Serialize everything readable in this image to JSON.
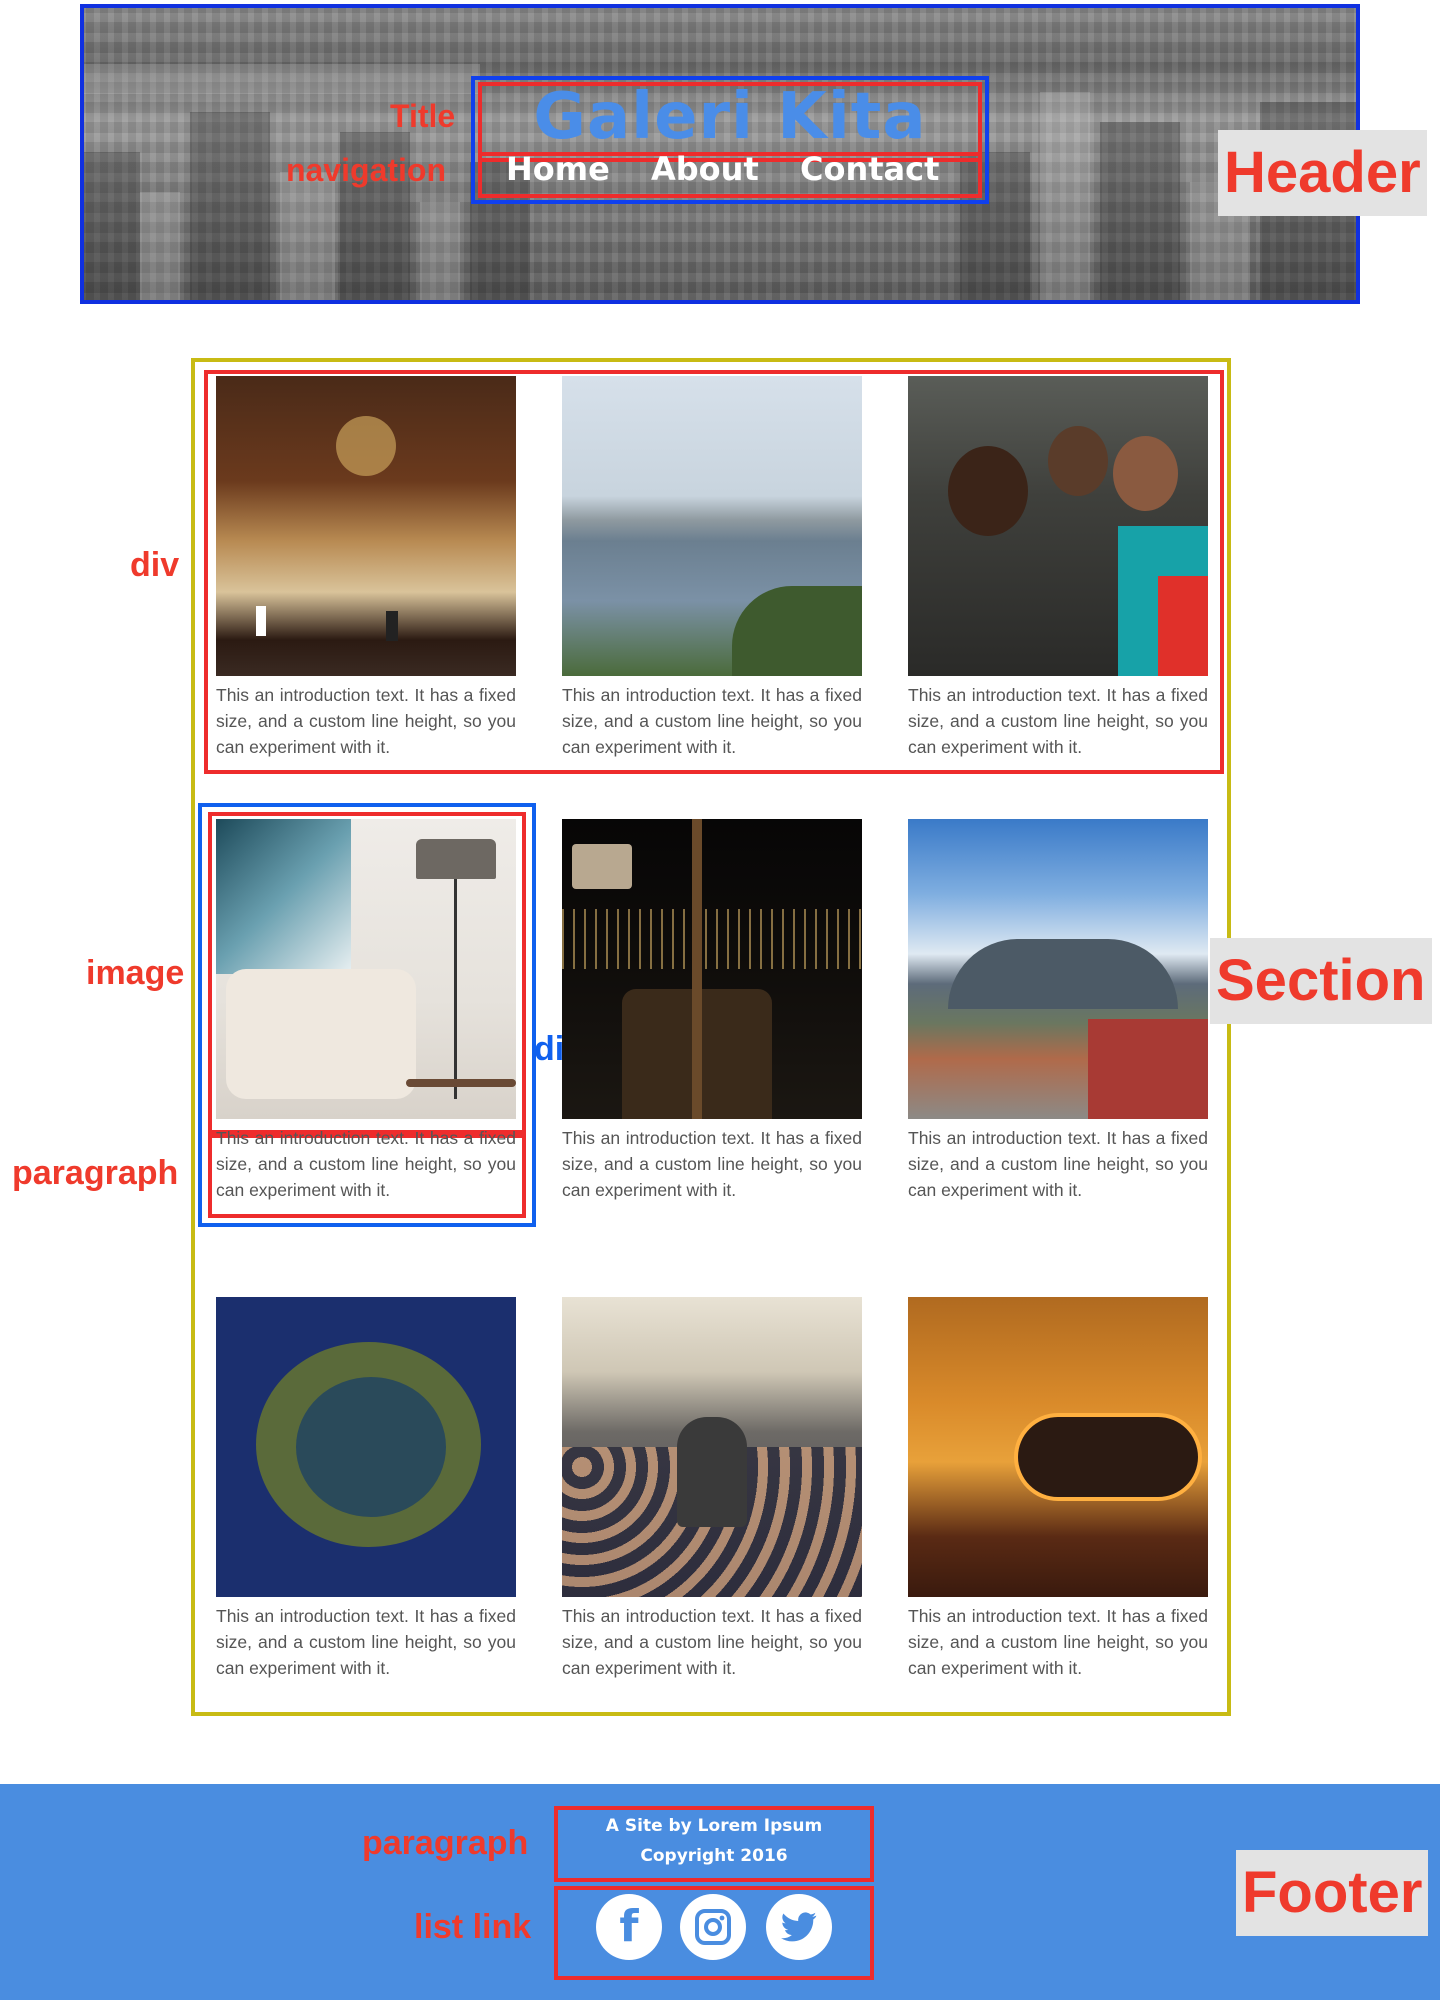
{
  "header": {
    "title": "Galeri Kita",
    "nav": [
      "Home",
      "About",
      "Contact"
    ],
    "labels": {
      "title": "Title",
      "navigation": "navigation",
      "header": "Header"
    }
  },
  "section": {
    "label": "Section",
    "annotations": {
      "div_row": "div",
      "image": "image",
      "div_card": "div",
      "paragraph": "paragraph"
    },
    "cards": [
      {
        "image": "hotel-lobby-photo",
        "text": "This an introduction text. It has a fixed size, and a custom line height, so you can experiment with it."
      },
      {
        "image": "lake-city-view-photo",
        "text": "This an introduction text. It has a fixed size, and a custom line height, so you can experiment with it."
      },
      {
        "image": "group-portrait-photo",
        "text": "This an introduction text. It has a fixed size, and a custom line height, so you can experiment with it."
      },
      {
        "image": "living-room-photo",
        "text": "This an introduction text. It has a fixed size, and a custom line height, so you can experiment with it."
      },
      {
        "image": "night-balcony-photo",
        "text": "This an introduction text. It has a fixed size, and a custom line height, so you can experiment with it."
      },
      {
        "image": "volcano-town-photo",
        "text": "This an introduction text. It has a fixed size, and a custom line height, so you can experiment with it."
      },
      {
        "image": "island-crater-photo",
        "text": "This an introduction text. It has a fixed size, and a custom line height, so you can experiment with it."
      },
      {
        "image": "crowd-selfie-photo",
        "text": "This an introduction text. It has a fixed size, and a custom line height, so you can experiment with it."
      },
      {
        "image": "sunset-cloud-photo",
        "text": "This an introduction text. It has a fixed size, and a custom line height, so you can experiment with it."
      }
    ]
  },
  "footer": {
    "lines": [
      "A Site by Lorem Ipsum",
      "Copyright 2016"
    ],
    "social": [
      {
        "icon": "facebook-icon",
        "glyph": "f"
      },
      {
        "icon": "instagram-icon",
        "glyph": ""
      },
      {
        "icon": "twitter-icon",
        "glyph": ""
      }
    ],
    "labels": {
      "paragraph": "paragraph",
      "list_link": "list link",
      "footer": "Footer"
    }
  },
  "colors": {
    "title_blue": "#4a8de8",
    "annotation_red": "#ef3a2c",
    "annotation_blue": "#1060ee",
    "section_border": "#c8bb14",
    "footer_bg": "#4a8de0"
  }
}
